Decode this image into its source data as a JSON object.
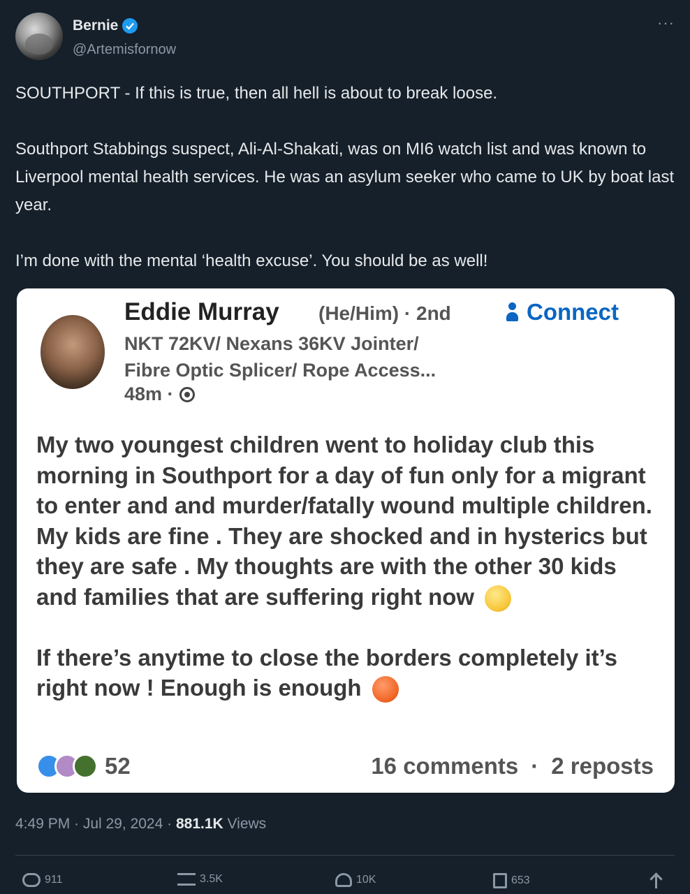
{
  "author": {
    "display_name": "Bernie",
    "handle": "@Artemisfornow",
    "verified": true,
    "more_label": "···"
  },
  "tweet": {
    "paragraphs": [
      "SOUTHPORT - If this is true, then all hell is about to break loose.",
      "Southport Stabbings suspect, Ali-Al-Shakati,  was on MI6 watch list and was known to Liverpool mental health services. He was an asylum seeker  who came  to UK by boat last year.",
      "I’m done with the mental ‘health excuse’. You should be as well!"
    ],
    "timestamp": "4:49 PM · Jul 29, 2024 · ",
    "views_count": "881.1K",
    "views_label": " Views"
  },
  "embedded_post": {
    "name": "Eddie Murray",
    "pronouns_degree": "(He/Him) · 2nd",
    "connect_label": "Connect",
    "headline_line1": "NKT 72KV/ Nexans 36KV Jointer/",
    "headline_line2": "Fibre Optic Splicer/ Rope Access...",
    "time": "48m ·",
    "body_paragraphs": [
      "My two youngest children went to holiday club this morning in Southport  for a day of fun only for a migrant to enter and and murder/fatally wound multiple children. My kids are fine . They are shocked and in hysterics but they are safe . My thoughts are with the other 30 kids and families that are suffering right now",
      "If there’s anytime to close the borders completely it’s right now !  Enough is enough"
    ],
    "reaction_count": "52",
    "comments": "16 comments",
    "stat_sep": "·",
    "reposts": "2 reposts"
  },
  "actions": {
    "replies": "911",
    "reposts": "3.5K",
    "likes": "10K",
    "bookmarks": "653"
  },
  "colors": {
    "background": "#15202b",
    "accent": "#1d9bf0",
    "linkedin_blue": "#0a66c2"
  }
}
